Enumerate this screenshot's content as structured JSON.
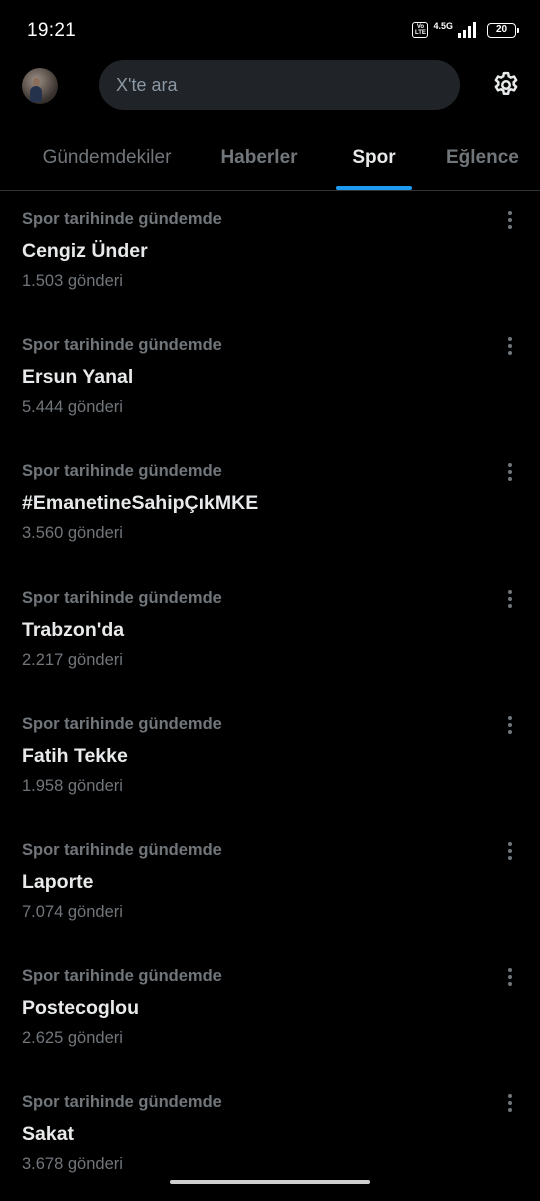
{
  "status_bar": {
    "time": "19:21",
    "volte_label": "Vo LTE",
    "network": "4.5G",
    "battery": "20"
  },
  "header": {
    "search_placeholder": "X'te ara"
  },
  "tabs": [
    {
      "label": "Gündemdekiler",
      "active": false
    },
    {
      "label": "Haberler",
      "active": false
    },
    {
      "label": "Spor",
      "active": true
    },
    {
      "label": "Eğlence",
      "active": false
    }
  ],
  "trends": [
    {
      "context": "Spor tarihinde gündemde",
      "name": "Cengiz Ünder",
      "count": "1.503 gönderi"
    },
    {
      "context": "Spor tarihinde gündemde",
      "name": "Ersun Yanal",
      "count": "5.444 gönderi"
    },
    {
      "context": "Spor tarihinde gündemde",
      "name": "#EmanetineSahipÇıkMKE",
      "count": "3.560 gönderi"
    },
    {
      "context": "Spor tarihinde gündemde",
      "name": "Trabzon'da",
      "count": "2.217 gönderi"
    },
    {
      "context": "Spor tarihinde gündemde",
      "name": "Fatih Tekke",
      "count": "1.958 gönderi"
    },
    {
      "context": "Spor tarihinde gündemde",
      "name": "Laporte",
      "count": "7.074 gönderi"
    },
    {
      "context": "Spor tarihinde gündemde",
      "name": "Postecoglou",
      "count": "2.625 gönderi"
    },
    {
      "context": "Spor tarihinde gündemde",
      "name": "Sakat",
      "count": "3.678 gönderi"
    }
  ],
  "colors": {
    "background": "#000000",
    "accent": "#1d9bf0",
    "text_primary": "#e7e9ea",
    "text_secondary": "#71767b",
    "search_bg": "#202327"
  }
}
